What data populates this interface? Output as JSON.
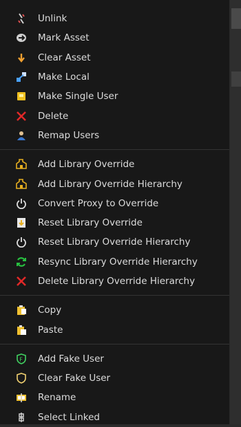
{
  "menu": {
    "groups": [
      [
        {
          "label": "Unlink",
          "icon": "unlink-icon"
        },
        {
          "label": "Mark Asset",
          "icon": "asset-icon"
        },
        {
          "label": "Clear Asset",
          "icon": "clear-asset-icon"
        },
        {
          "label": "Make Local",
          "icon": "make-local-icon"
        },
        {
          "label": "Make Single User",
          "icon": "single-user-icon"
        },
        {
          "label": "Delete",
          "icon": "delete-icon"
        },
        {
          "label": "Remap Users",
          "icon": "remap-users-icon"
        }
      ],
      [
        {
          "label": "Add Library Override",
          "icon": "library-override-icon"
        },
        {
          "label": "Add Library Override Hierarchy",
          "icon": "library-override-icon"
        },
        {
          "label": "Convert Proxy to Override",
          "icon": "power-icon"
        },
        {
          "label": "Reset Library Override",
          "icon": "reset-override-icon"
        },
        {
          "label": "Reset Library Override Hierarchy",
          "icon": "power-icon"
        },
        {
          "label": "Resync Library Override Hierarchy",
          "icon": "resync-icon"
        },
        {
          "label": "Delete Library Override Hierarchy",
          "icon": "delete-icon"
        }
      ],
      [
        {
          "label": "Copy",
          "icon": "copy-icon"
        },
        {
          "label": "Paste",
          "icon": "paste-icon"
        }
      ],
      [
        {
          "label": "Add Fake User",
          "icon": "fake-user-add-icon"
        },
        {
          "label": "Clear Fake User",
          "icon": "fake-user-clear-icon"
        },
        {
          "label": "Rename",
          "icon": "rename-icon"
        },
        {
          "label": "Select Linked",
          "icon": "select-linked-icon"
        }
      ]
    ]
  },
  "colors": {
    "menu_bg": "#181818",
    "text": "#dcdcdc",
    "separator": "#343434"
  }
}
